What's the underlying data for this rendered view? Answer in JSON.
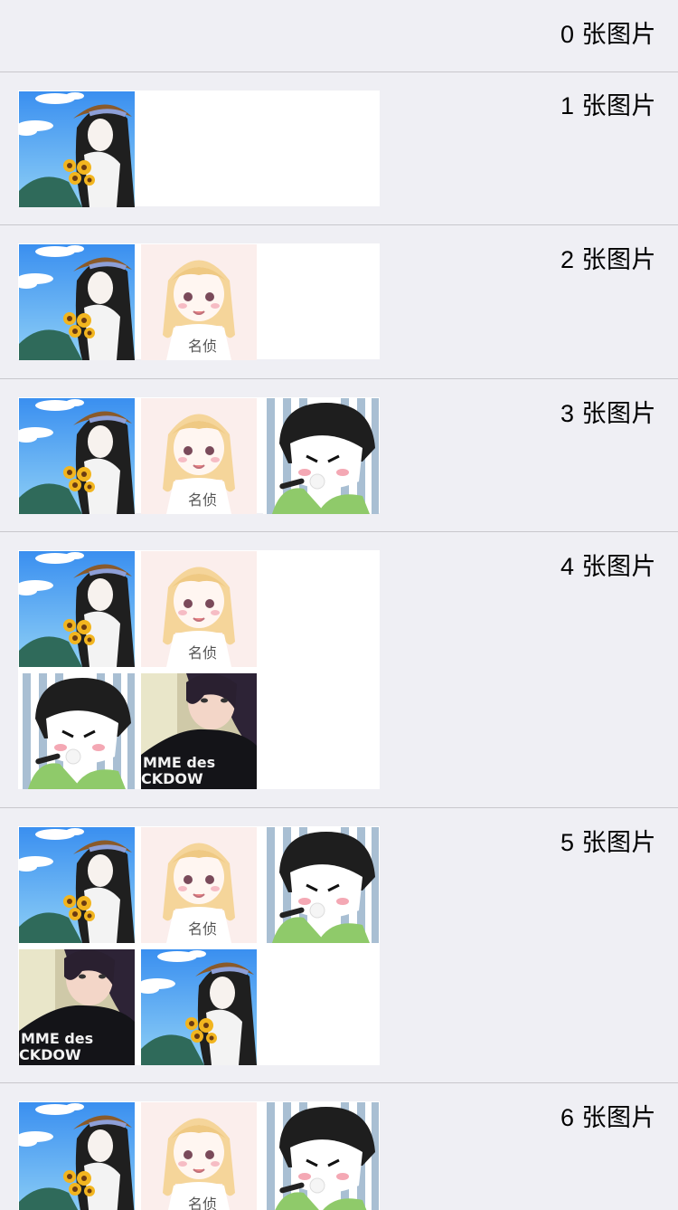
{
  "rows": [
    {
      "label": "0 张图片",
      "images": []
    },
    {
      "label": "1 张图片",
      "images": [
        "sunflower-girl"
      ]
    },
    {
      "label": "2 张图片",
      "images": [
        "sunflower-girl",
        "blonde-anime-girl"
      ]
    },
    {
      "label": "3 张图片",
      "images": [
        "sunflower-girl",
        "blonde-anime-girl",
        "laughing-boy"
      ]
    },
    {
      "label": "4 张图片",
      "images": [
        "sunflower-girl",
        "blonde-anime-girl",
        "laughing-boy",
        "girl-black-shirt"
      ]
    },
    {
      "label": "5 张图片",
      "images": [
        "sunflower-girl",
        "blonde-anime-girl",
        "laughing-boy",
        "girl-black-shirt",
        "sunflower-girl"
      ]
    },
    {
      "label": "6 张图片",
      "images": [
        "sunflower-girl",
        "blonde-anime-girl",
        "laughing-boy"
      ]
    }
  ],
  "image_text": {
    "blonde-anime-girl": "名侦",
    "girl-black-shirt": [
      "MME des",
      "CKDOW"
    ]
  },
  "colors": {
    "background": "#efeff4",
    "separator": "#c8c7cc",
    "grid_background": "#ffffff",
    "text": "#000000"
  }
}
